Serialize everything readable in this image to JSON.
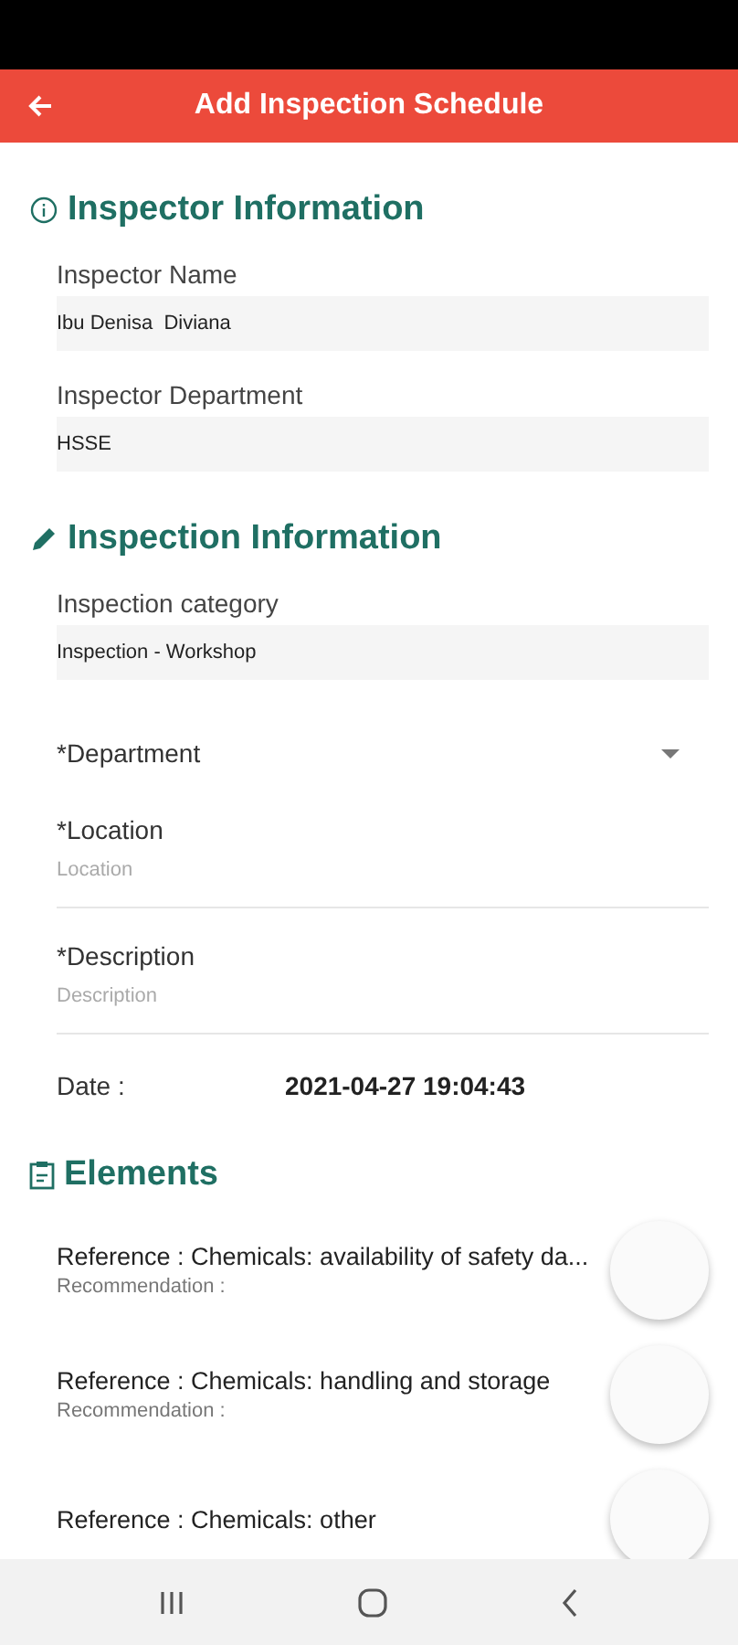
{
  "header": {
    "title": "Add Inspection Schedule"
  },
  "inspector_section": {
    "title": "Inspector Information",
    "fields": [
      {
        "label": "Inspector Name",
        "value": "Ibu Denisa  Diviana"
      },
      {
        "label": "Inspector Department",
        "value": "HSSE"
      }
    ]
  },
  "inspection_section": {
    "title": "Inspection Information",
    "fields": [
      {
        "kind": "readonly",
        "label": "Inspection category",
        "value": "Inspection - Workshop"
      },
      {
        "kind": "dropdown",
        "label": "*Department"
      },
      {
        "kind": "input",
        "label": "*Location",
        "placeholder": "Location"
      },
      {
        "kind": "input",
        "label": "*Description",
        "placeholder": "Description"
      }
    ],
    "date_label": "Date :",
    "date_value": "2021-04-27 19:04:43"
  },
  "elements_section": {
    "title": "Elements",
    "items": [
      {
        "reference": "Reference : Chemicals: availability of safety da...",
        "recommendation": "Recommendation :"
      },
      {
        "reference": "Reference : Chemicals: handling and storage",
        "recommendation": "Recommendation :"
      },
      {
        "reference": "Reference : Chemicals: other"
      }
    ]
  }
}
